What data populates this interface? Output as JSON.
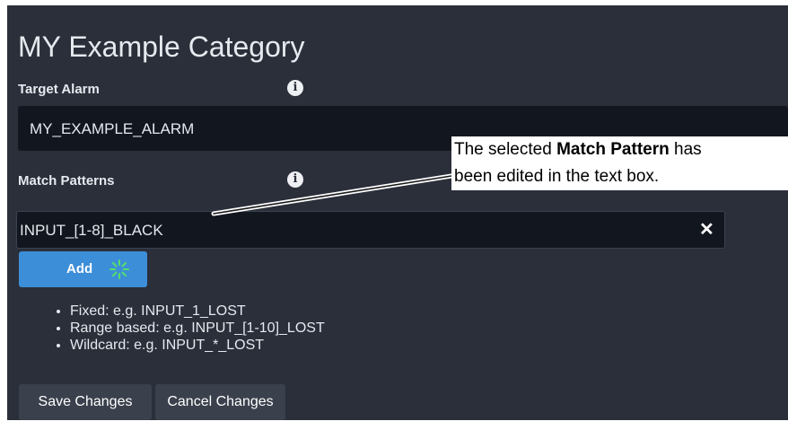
{
  "page": {
    "title": "MY Example Category"
  },
  "target_alarm": {
    "label": "Target Alarm",
    "value": "MY_EXAMPLE_ALARM"
  },
  "match_patterns": {
    "label": "Match Patterns",
    "input_value": "INPUT_[1-8]_BLACK",
    "add_label": "Add",
    "hints": [
      "Fixed: e.g. INPUT_1_LOST",
      "Range based: e.g. INPUT_[1-10]_LOST",
      "Wildcard: e.g. INPUT_*_LOST"
    ]
  },
  "actions": {
    "save_label": "Save Changes",
    "cancel_label": "Cancel Changes"
  },
  "callout": {
    "line1_prefix": "The selected ",
    "line1_bold": "Match Pattern",
    "line1_suffix": " has",
    "line2": "been edited in the text box."
  },
  "icons": {
    "info": "info-icon",
    "clear": "close-icon",
    "busy": "spinner-icon"
  },
  "colors": {
    "panel_background": "#2a2f3a",
    "field_background": "#12161f",
    "accent_button": "#3d8ed8",
    "secondary_button": "#3a404c",
    "spinner": "#54e06a",
    "callout_background": "#ffffff"
  }
}
